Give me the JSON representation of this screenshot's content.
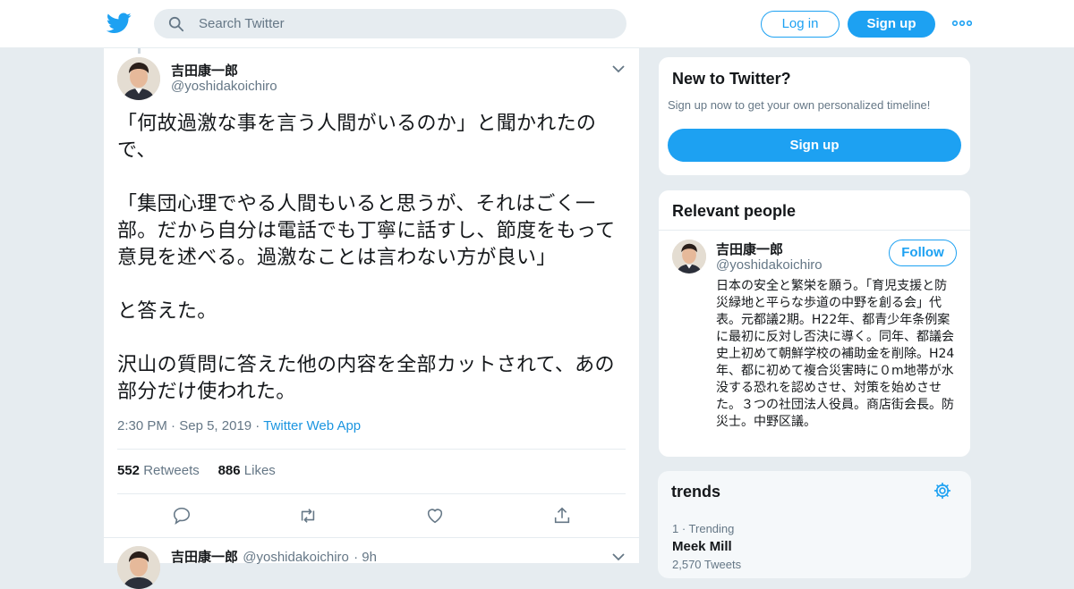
{
  "header": {
    "search_placeholder": "Search Twitter",
    "login_label": "Log in",
    "signup_label": "Sign up",
    "logo_icon": "twitter-bird-icon",
    "more_icon": "more-dots-icon",
    "accent_color": "#1da1f2"
  },
  "tweet": {
    "author_name": "吉田康一郎",
    "author_handle": "@yoshidakoichiro",
    "text": "「何故過激な事を言う人間がいるのか」と聞かれたので、\n\n「集団心理でやる人間もいると思うが、それはごく一部。だから自分は電話でも丁寧に話すし、節度をもって意見を述べる。過激なことは言わない方が良い」\n\nと答えた。\n\n沢山の質問に答えた他の内容を全部カットされて、あの部分だけ使われた。",
    "time": "2:30 PM",
    "date": "Sep 5, 2019",
    "source": "Twitter Web App",
    "retweets_count": "552",
    "retweets_label": "Retweets",
    "likes_count": "886",
    "likes_label": "Likes",
    "actions": [
      "reply-icon",
      "retweet-icon",
      "like-icon",
      "share-icon"
    ]
  },
  "next_tweet": {
    "author_name": "吉田康一郎",
    "author_handle": "@yoshidakoichiro",
    "age": "9h"
  },
  "new_to_twitter": {
    "title": "New to Twitter?",
    "subtitle": "Sign up now to get your own personalized timeline!",
    "button_label": "Sign up"
  },
  "relevant_people": {
    "title": "Relevant people",
    "name": "吉田康一郎",
    "handle": "@yoshidakoichiro",
    "follow_label": "Follow",
    "bio": "日本の安全と繁栄を願う。「育児支援と防災緑地と平らな歩道の中野を創る会」代表。元都議2期。H22年、都青少年条例案に最初に反対し否決に導く。同年、都議会史上初めて朝鮮学校の補助金を削除。H24年、都に初めて複合災害時に０m地帯が水没する恐れを認めさせ、対策を始めさせた。３つの社団法人役員。商店街会長。防災士。中野区議。"
  },
  "trends": {
    "title": "trends",
    "settings_icon": "gear-icon",
    "items": [
      {
        "meta": "1 · Trending",
        "name": "Meek Mill",
        "count": "2,570 Tweets"
      }
    ]
  }
}
